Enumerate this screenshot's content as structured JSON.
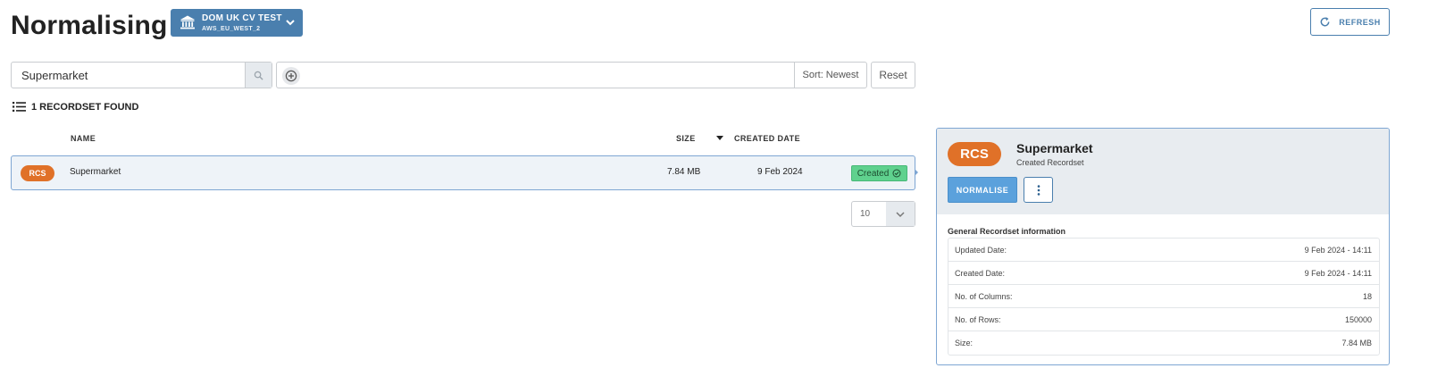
{
  "header": {
    "title": "Normalising",
    "environment": {
      "name": "DOM UK CV TEST",
      "region": "AWS_EU_WEST_2"
    },
    "refresh_label": "REFRESH"
  },
  "filters": {
    "search_value": "Supermarket",
    "sort_label": "Sort: Newest",
    "reset_label": "Reset"
  },
  "results": {
    "count_label": "1 RECORDSET FOUND",
    "columns": {
      "name": "NAME",
      "size": "SIZE",
      "created_date": "CREATED DATE"
    },
    "rows": [
      {
        "badge": "RCS",
        "name": "Supermarket",
        "size": "7.84 MB",
        "created_date": "9 Feb 2024",
        "status": "Created"
      }
    ],
    "page_size": "10"
  },
  "detail": {
    "badge": "RCS",
    "title": "Supermarket",
    "subtitle": "Created Recordset",
    "normalise_label": "NORMALISE",
    "info_heading": "General Recordset information",
    "info": [
      {
        "label": "Updated Date:",
        "value": "9 Feb 2024 - 14:11"
      },
      {
        "label": "Created Date:",
        "value": "9 Feb 2024 - 14:11"
      },
      {
        "label": "No. of Columns:",
        "value": "18"
      },
      {
        "label": "No. of Rows:",
        "value": "150000"
      },
      {
        "label": "Size:",
        "value": "7.84 MB"
      }
    ]
  },
  "colors": {
    "accent": "#4a7fae",
    "rcs_badge": "#e07128",
    "status_created": "#5fd18e",
    "normalise_button": "#5ba1dc"
  },
  "icons": [
    "bank-icon",
    "chevron-down-icon",
    "refresh-icon",
    "search-icon",
    "add-circle-icon",
    "list-icon",
    "sort-desc-icon",
    "check-circle-icon",
    "more-vertical-icon"
  ]
}
